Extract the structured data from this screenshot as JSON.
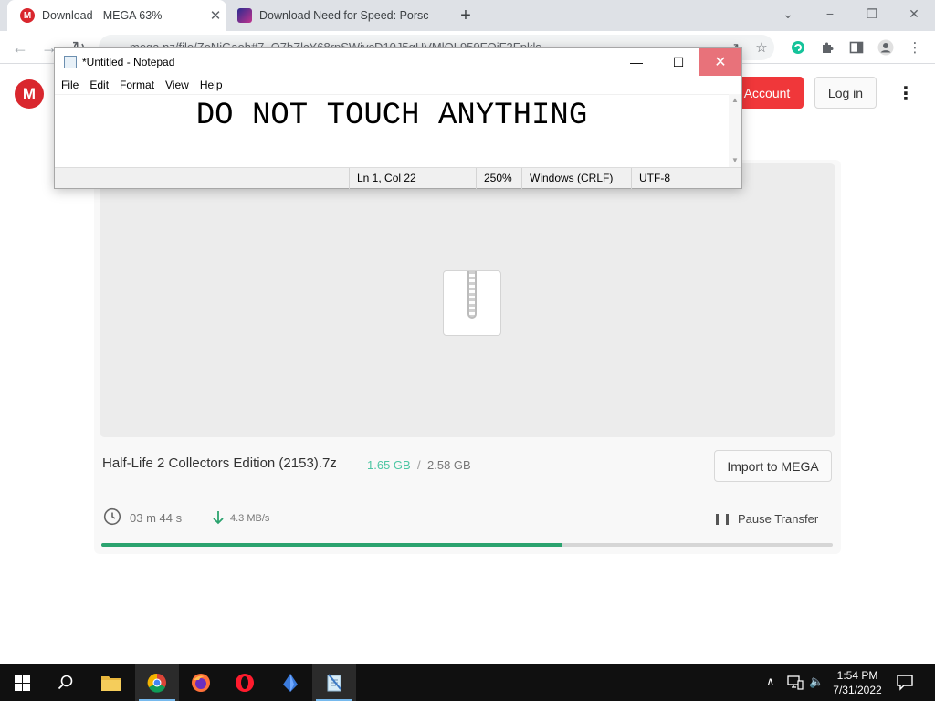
{
  "browser": {
    "tabs": [
      {
        "title": "Download - MEGA 63%",
        "active": true
      },
      {
        "title": "Download Need for Speed: Porsc",
        "active": false
      }
    ],
    "new_tab": "+",
    "window_controls": {
      "minimize": "−",
      "restore": "❐",
      "close": "✕"
    },
    "address": "mega.nz/file/ZoNiGaoh#7_O7bZlcY68rpSWivcD10J5gHVMlOL959FOiF3Fpkls",
    "nav": {
      "back": "←",
      "forward": "→",
      "reload": "↻"
    },
    "toolbar_icons": {
      "share": "↗",
      "bookmark": "☆",
      "menu": "⋮"
    }
  },
  "mega": {
    "logo": "M",
    "account_button": "Account",
    "login_button": "Log in",
    "kebab": "⋮",
    "file_name": "Half-Life 2 Collectors Edition (2153).7z",
    "downloaded": "1.65 GB",
    "size_separator": "/",
    "total_size": "2.58 GB",
    "import_button": "Import to MEGA",
    "time_left": "03 m  44 s",
    "speed": "4.3 MB/s",
    "pause_button": "Pause Transfer",
    "progress_percent": 63,
    "accent_green": "#2ba36f",
    "accent_red": "#d9272e"
  },
  "notepad": {
    "title": "*Untitled - Notepad",
    "menu": [
      "File",
      "Edit",
      "Format",
      "View",
      "Help"
    ],
    "text": "DO NOT TOUCH ANYTHING",
    "controls": {
      "minimize": "—",
      "maximize": "☐",
      "close": "✕"
    },
    "status": {
      "position": "Ln 1, Col 22",
      "zoom": "250%",
      "line_endings": "Windows (CRLF)",
      "encoding": "UTF-8"
    }
  },
  "taskbar": {
    "apps": [
      "start-icon",
      "search-icon",
      "file-explorer-icon",
      "chrome-icon",
      "firefox-icon",
      "opera-icon",
      "crystal-app-icon",
      "notepad-icon"
    ],
    "tray": {
      "chevron": "∧",
      "volume": "🔈"
    },
    "time": "1:54 PM",
    "date": "7/31/2022"
  }
}
